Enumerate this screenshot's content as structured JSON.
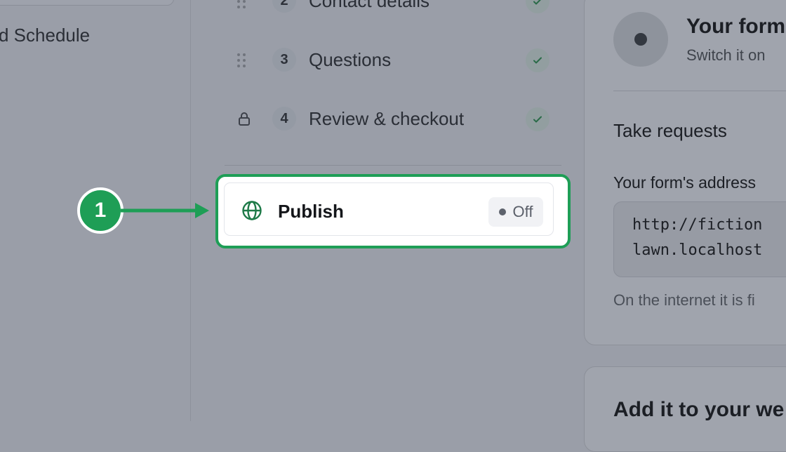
{
  "left_panel": {
    "item_label": "d Schedule"
  },
  "steps": [
    {
      "number": "2",
      "label": "Contact details",
      "control": "drag-handle"
    },
    {
      "number": "3",
      "label": "Questions",
      "control": "drag-handle"
    },
    {
      "number": "4",
      "label": "Review & checkout",
      "control": "lock"
    }
  ],
  "publish": {
    "title": "Publish",
    "status": "Off",
    "icon": "globe-icon"
  },
  "annotation": {
    "number": "1"
  },
  "settings": {
    "title": "Your form",
    "subtitle": "Switch it on",
    "section_heading": "Take requests",
    "address_label": "Your form's address",
    "address_line1": "http://fiction",
    "address_line2": "lawn.localhost",
    "note": "On the internet it is fi"
  },
  "embed": {
    "title": "Add it to your we"
  },
  "colors": {
    "accent": "#1e9e56",
    "overlay": "#9a9ea8"
  }
}
